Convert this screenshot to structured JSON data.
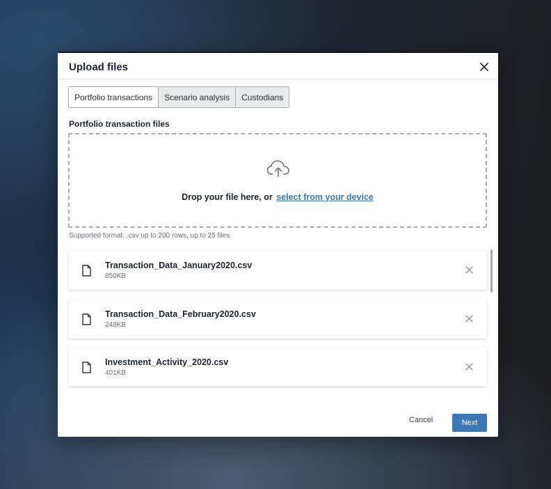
{
  "modal": {
    "title": "Upload files",
    "close_icon": "close-icon"
  },
  "tabs": [
    {
      "label": "Portfolio transactions",
      "active": true
    },
    {
      "label": "Scenario analysis",
      "active": false
    },
    {
      "label": "Custodians",
      "active": false
    }
  ],
  "upload": {
    "section_title": "Portfolio transaction files",
    "icon": "cloud-upload-icon",
    "drop_text": "Drop your file here, or",
    "select_link": "select from your device",
    "hint": "Supported format: .csv up to 200 rows, up to 25 files"
  },
  "files": [
    {
      "name": "Transaction_Data_January2020.csv",
      "size": "850KB"
    },
    {
      "name": "Transaction_Data_February2020.csv",
      "size": "248KB"
    },
    {
      "name": "Investment_Activity_2020.csv",
      "size": "401KB"
    }
  ],
  "footer": {
    "cancel_label": "Cancel",
    "next_label": "Next"
  },
  "colors": {
    "accent": "#3a78b8",
    "title": "#1c2330"
  }
}
